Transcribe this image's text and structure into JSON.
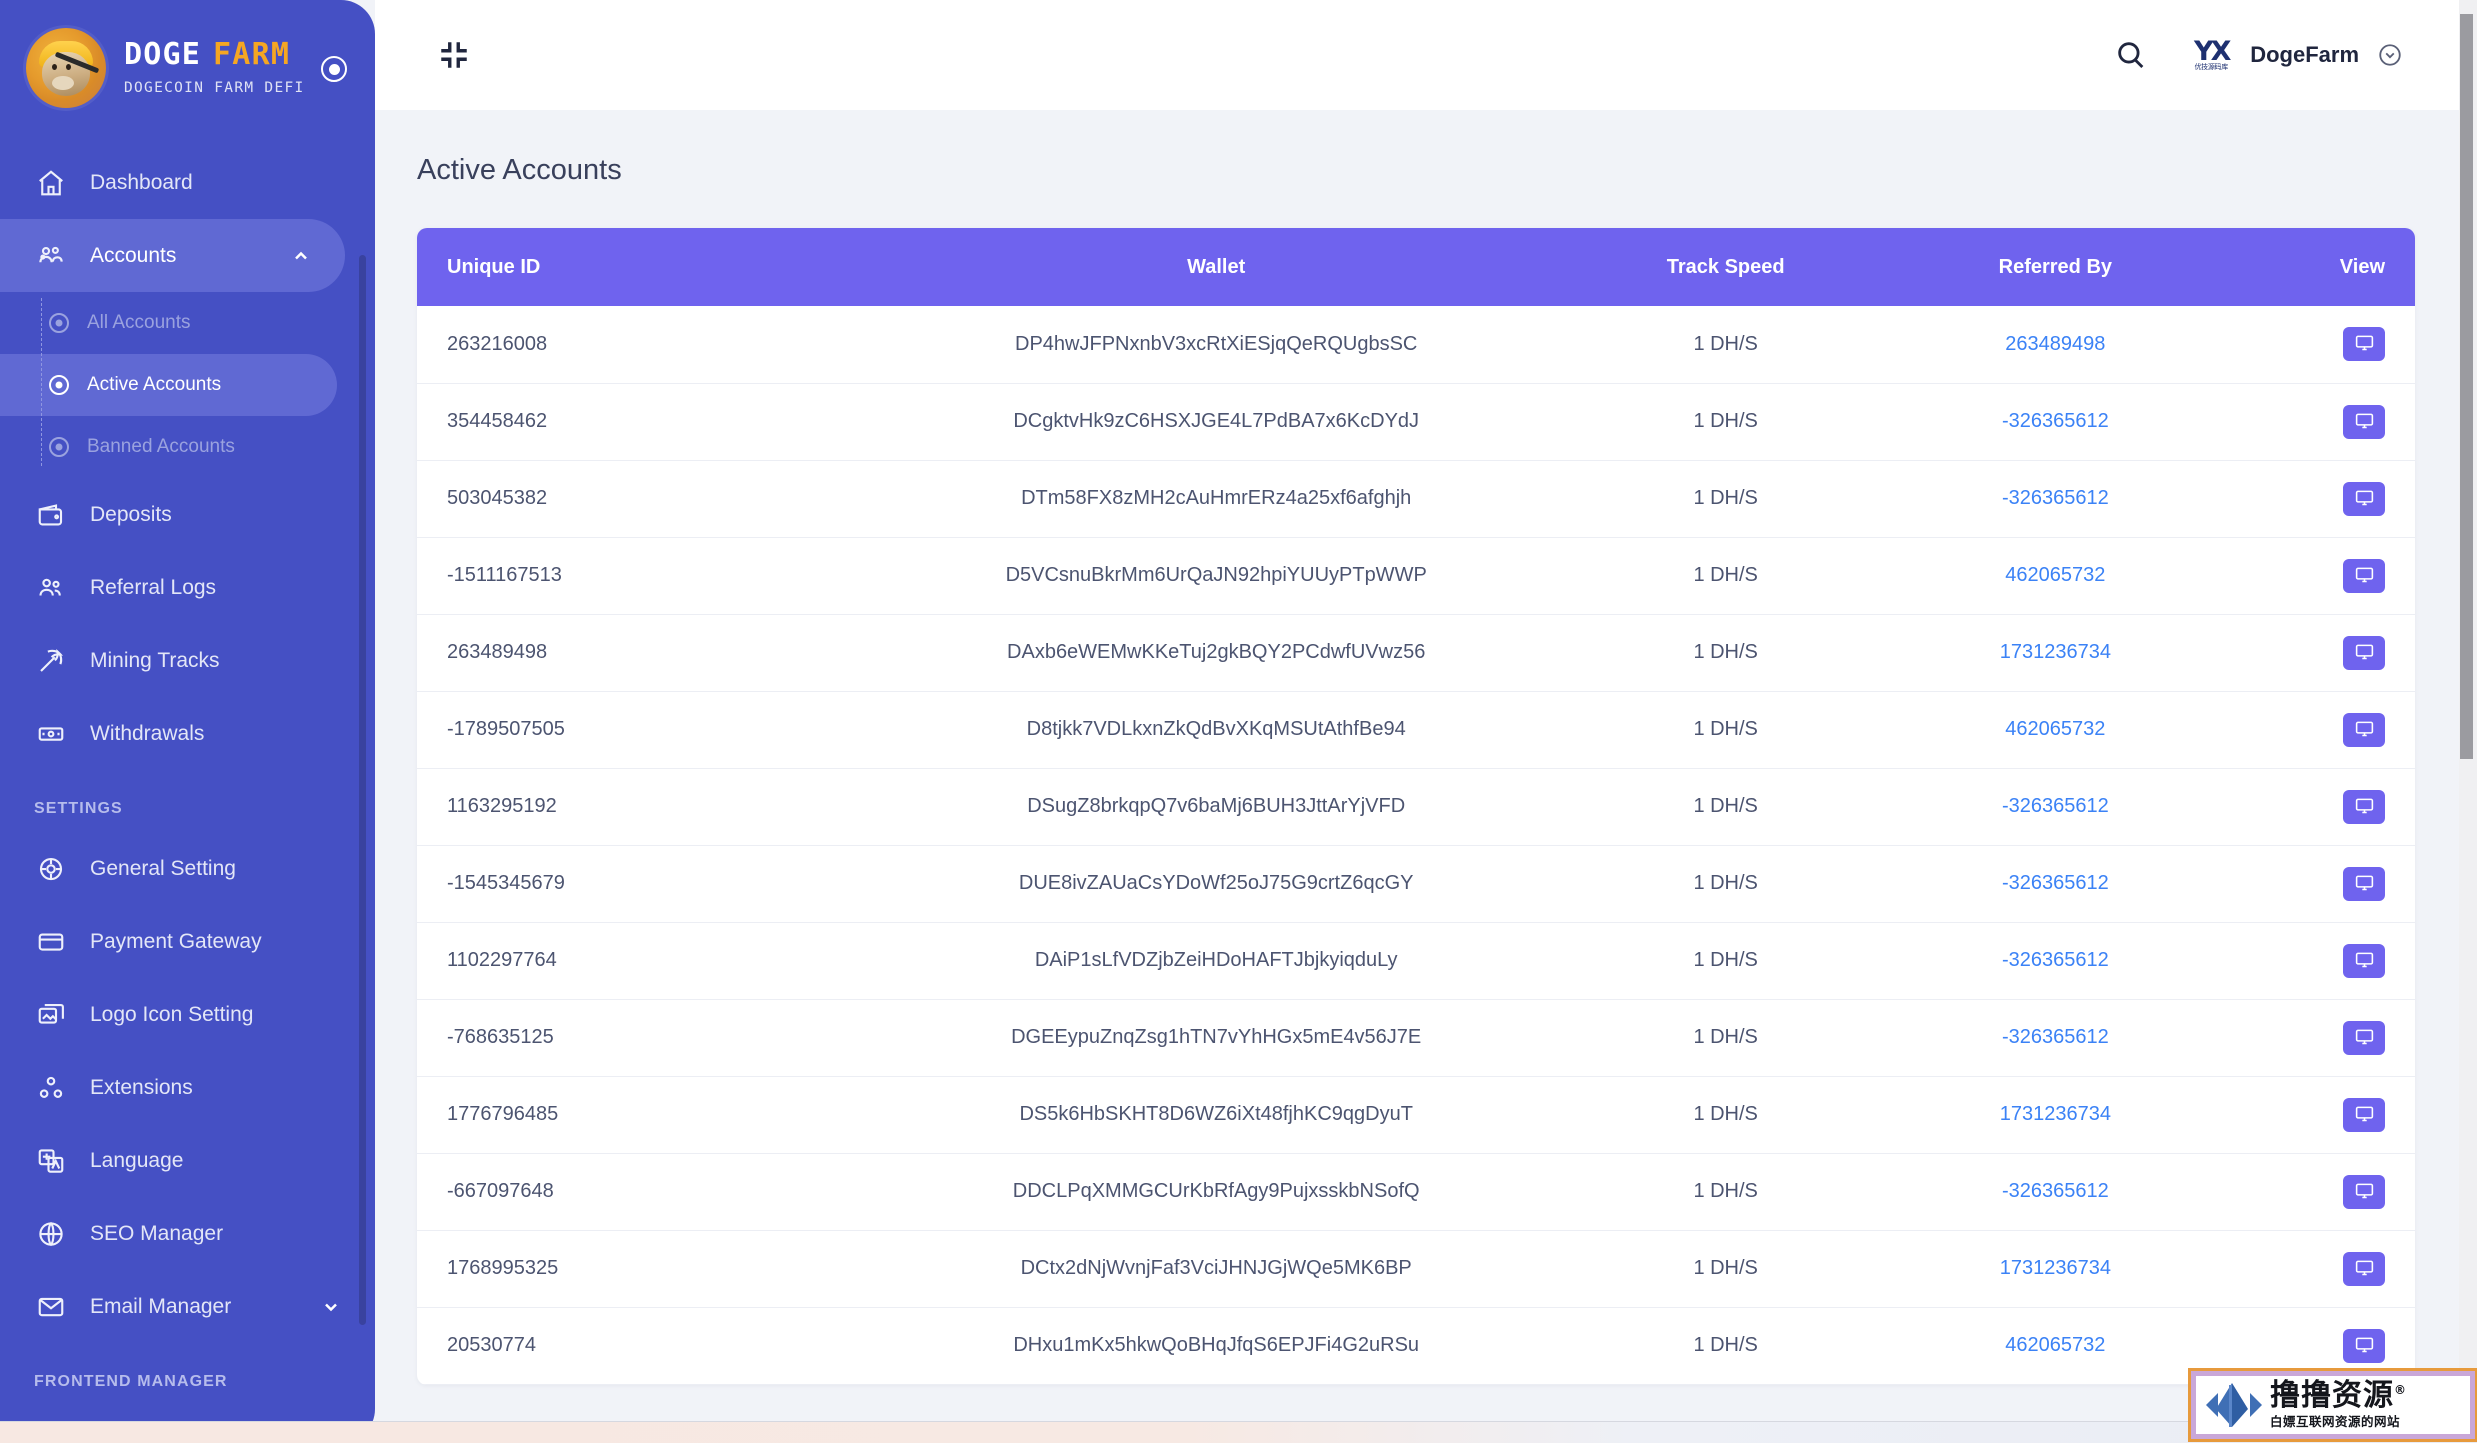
{
  "brand": {
    "title_primary": "DOGE",
    "title_accent": "FARM",
    "subtitle": "DOGECOIN FARM DEFI",
    "accent_color": "#f5a623",
    "sidebar_color": "#4550c4"
  },
  "sidebar": {
    "items": [
      {
        "label": "Dashboard",
        "icon": "home-icon"
      },
      {
        "label": "Accounts",
        "icon": "users-group-icon",
        "expanded": true
      },
      {
        "label": "Deposits",
        "icon": "wallet-icon"
      },
      {
        "label": "Referral Logs",
        "icon": "people-icon"
      },
      {
        "label": "Mining Tracks",
        "icon": "pickaxe-icon"
      },
      {
        "label": "Withdrawals",
        "icon": "banknote-icon"
      }
    ],
    "accounts_submenu": [
      {
        "label": "All Accounts",
        "active": false
      },
      {
        "label": "Active Accounts",
        "active": true
      },
      {
        "label": "Banned Accounts",
        "active": false
      }
    ],
    "settings_header": "SETTINGS",
    "settings_items": [
      {
        "label": "General Setting",
        "icon": "gear-globe-icon"
      },
      {
        "label": "Payment Gateway",
        "icon": "credit-card-icon"
      },
      {
        "label": "Logo Icon Setting",
        "icon": "images-icon"
      },
      {
        "label": "Extensions",
        "icon": "extensions-icon"
      },
      {
        "label": "Language",
        "icon": "translate-icon"
      },
      {
        "label": "SEO Manager",
        "icon": "globe-icon"
      },
      {
        "label": "Email Manager",
        "icon": "envelope-icon",
        "expandable": true
      }
    ],
    "frontend_header": "FRONTEND MANAGER"
  },
  "topbar": {
    "collapse_icon": "collapse-icon",
    "search_icon": "search-icon",
    "avatar_text": "YX",
    "avatar_sub": "优技源码库",
    "user_name": "DogeFarm",
    "caret_icon": "chevron-down-circle-icon"
  },
  "page": {
    "title": "Active Accounts"
  },
  "table": {
    "header_color": "#6f63ee",
    "columns": [
      "Unique ID",
      "Wallet",
      "Track Speed",
      "Referred By",
      "View"
    ],
    "view_icon": "monitor-icon",
    "link_color": "#3b82f6",
    "rows": [
      {
        "id": "263216008",
        "wallet": "DP4hwJFPNxnbV3xcRtXiESjqQeRQUgbsSC",
        "speed": "1 DH/S",
        "referred_by": "263489498"
      },
      {
        "id": "354458462",
        "wallet": "DCgktvHk9zC6HSXJGE4L7PdBA7x6KcDYdJ",
        "speed": "1 DH/S",
        "referred_by": "-326365612"
      },
      {
        "id": "503045382",
        "wallet": "DTm58FX8zMH2cAuHmrERz4a25xf6afghjh",
        "speed": "1 DH/S",
        "referred_by": "-326365612"
      },
      {
        "id": "-1511167513",
        "wallet": "D5VCsnuBkrMm6UrQaJN92hpiYUUyPTpWWP",
        "speed": "1 DH/S",
        "referred_by": "462065732"
      },
      {
        "id": "263489498",
        "wallet": "DAxb6eWEMwKKeTuj2gkBQY2PCdwfUVwz56",
        "speed": "1 DH/S",
        "referred_by": "1731236734"
      },
      {
        "id": "-1789507505",
        "wallet": "D8tjkk7VDLkxnZkQdBvXKqMSUtAthfBe94",
        "speed": "1 DH/S",
        "referred_by": "462065732"
      },
      {
        "id": "1163295192",
        "wallet": "DSugZ8brkqpQ7v6baMj6BUH3JttArYjVFD",
        "speed": "1 DH/S",
        "referred_by": "-326365612"
      },
      {
        "id": "-1545345679",
        "wallet": "DUE8ivZAUaCsYDoWf25oJ75G9crtZ6qcGY",
        "speed": "1 DH/S",
        "referred_by": "-326365612"
      },
      {
        "id": "1102297764",
        "wallet": "DAiP1sLfVDZjbZeiHDoHAFTJbjkyiqduLy",
        "speed": "1 DH/S",
        "referred_by": "-326365612"
      },
      {
        "id": "-768635125",
        "wallet": "DGEEypuZnqZsg1hTN7vYhHGx5mE4v56J7E",
        "speed": "1 DH/S",
        "referred_by": "-326365612"
      },
      {
        "id": "1776796485",
        "wallet": "DS5k6HbSKHT8D6WZ6iXt48fjhKC9qgDyuT",
        "speed": "1 DH/S",
        "referred_by": "1731236734"
      },
      {
        "id": "-667097648",
        "wallet": "DDCLPqXMMGCUrKbRfAgy9PujxsskbNSofQ",
        "speed": "1 DH/S",
        "referred_by": "-326365612"
      },
      {
        "id": "1768995325",
        "wallet": "DCtx2dNjWvnjFaf3VciJHNJGjWQe5MK6BP",
        "speed": "1 DH/S",
        "referred_by": "1731236734"
      },
      {
        "id": "20530774",
        "wallet": "DHxu1mKx5hkwQoBHqJfqS6EPJFi4G2uRSu",
        "speed": "1 DH/S",
        "referred_by": "462065732"
      }
    ]
  },
  "watermark": {
    "main": "撸撸资源",
    "registered": "®",
    "sub": "白嫖互联网资源的网站"
  }
}
